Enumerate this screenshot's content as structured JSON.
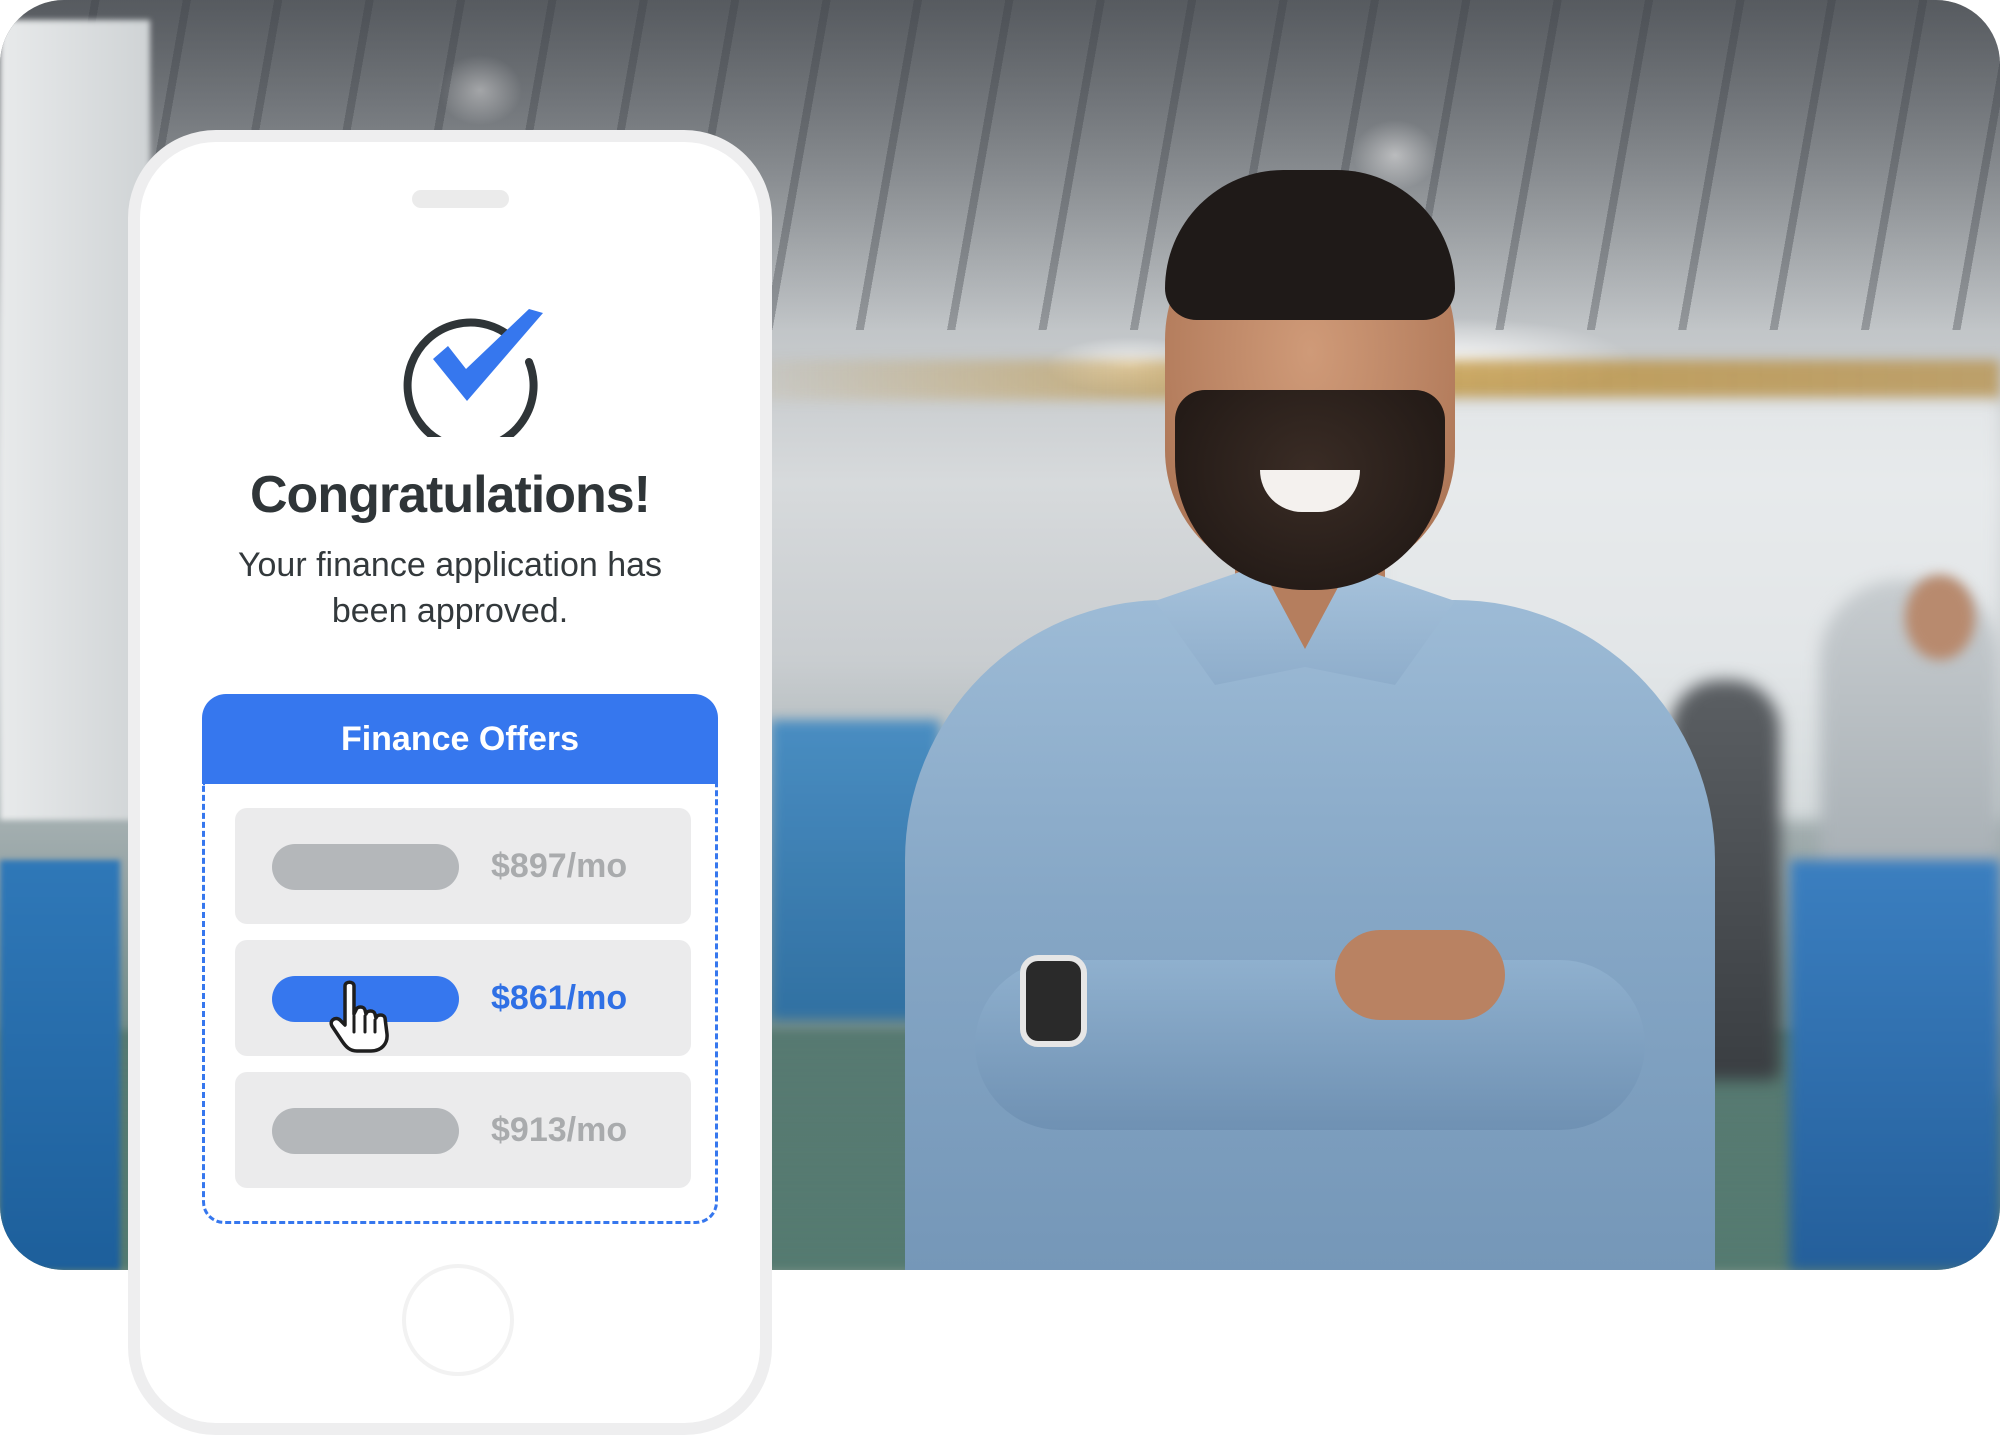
{
  "approval": {
    "title": "Congratulations!",
    "message": "Your finance application has been approved."
  },
  "offers": {
    "header": "Finance Offers",
    "items": [
      {
        "price": "$897/mo",
        "selected": false
      },
      {
        "price": "$861/mo",
        "selected": true
      },
      {
        "price": "$913/mo",
        "selected": false
      }
    ]
  },
  "icons": {
    "status": "check-circle-icon",
    "pointer": "hand-pointer-icon"
  },
  "colors": {
    "accent": "#3677ee",
    "text_dark": "#2f3538",
    "muted": "#a9abad",
    "row_bg": "#ebebec"
  }
}
